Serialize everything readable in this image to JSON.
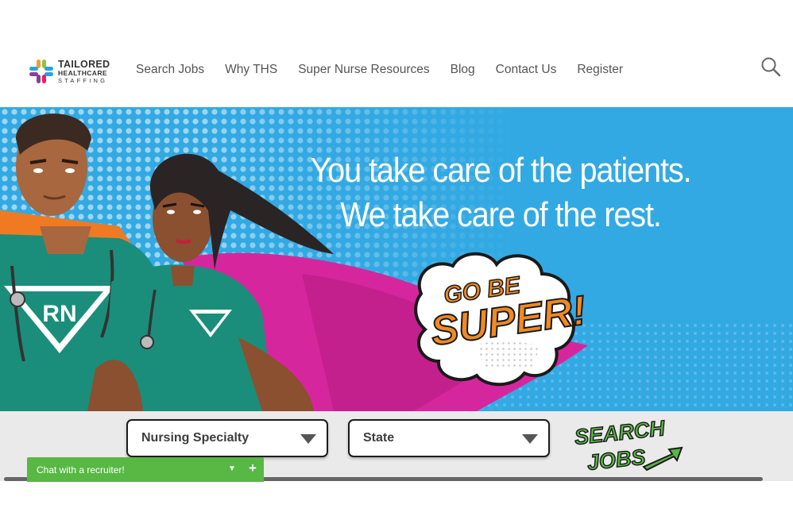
{
  "header": {
    "logo": {
      "line1": "TAILORED",
      "line2": "HEALTHCARE",
      "line3": "STAFFING"
    },
    "nav": [
      {
        "label": "Search Jobs"
      },
      {
        "label": "Why THS"
      },
      {
        "label": "Super Nurse Resources"
      },
      {
        "label": "Blog"
      },
      {
        "label": "Contact Us"
      },
      {
        "label": "Register"
      }
    ],
    "search_icon": "search-icon"
  },
  "hero": {
    "tagline_line1": "You take care of the patients.",
    "tagline_line2": "We take care of the rest.",
    "burst_line1": "GO BE",
    "burst_line2": "SUPER!",
    "male_badge": "RN",
    "background_color": "#33a9e3"
  },
  "search": {
    "specialty": {
      "value": "Nursing Specialty"
    },
    "state": {
      "value": "State"
    },
    "button_line1": "SEARCH",
    "button_line2": "JOBS"
  },
  "chat": {
    "label": "Chat with a recruiter!",
    "minimize_icon": "chevron-down-icon",
    "expand_icon": "plus-icon"
  },
  "colors": {
    "hero_blue": "#33a9e3",
    "scrubs_green": "#1a8e7a",
    "cape_magenta": "#d6269d",
    "burst_orange": "#f08a24",
    "button_green": "#57b844"
  }
}
